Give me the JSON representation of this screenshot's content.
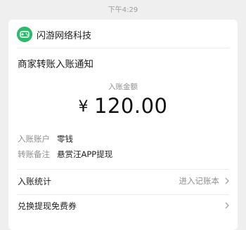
{
  "timestamp": "下午4:29",
  "sender": {
    "name": "闪游网络科技",
    "avatar_icon": "game-controller-icon",
    "avatar_color": "#2fb96c"
  },
  "notice": {
    "title": "商家转账入账通知",
    "amount_label": "入账金额",
    "currency": "¥",
    "amount": "120.00",
    "details": [
      {
        "label": "入账账户",
        "value": "零钱"
      },
      {
        "label": "转账备注",
        "value": "悬赏汪APP提现"
      }
    ]
  },
  "links": {
    "stats_label": "入账统计",
    "stats_action": "进入记账本",
    "coupon_label": "兑换提现免费券"
  }
}
